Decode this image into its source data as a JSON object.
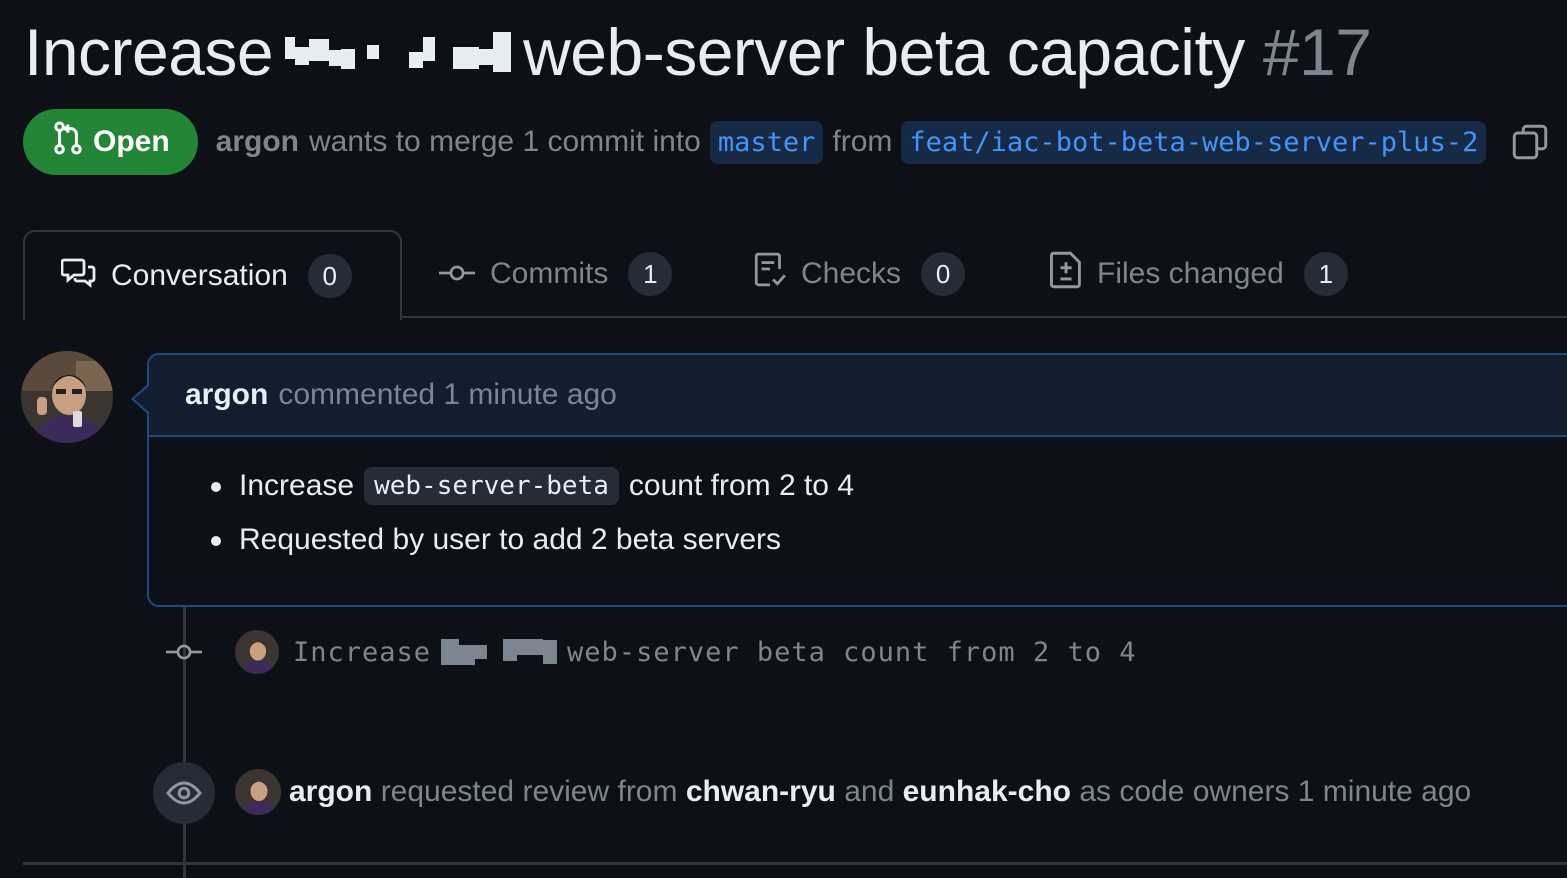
{
  "pr": {
    "title_start": "Increase",
    "title_end": "web-server beta capacity",
    "number": "#17",
    "state": "Open",
    "author": "argon",
    "merge_text": "wants to merge 1 commit into",
    "base_branch": "master",
    "from_text": "from",
    "head_branch": "feat/iac-bot-beta-web-server-plus-2"
  },
  "tabs": [
    {
      "label": "Conversation",
      "count": "0",
      "icon": "comment-discussion-icon"
    },
    {
      "label": "Commits",
      "count": "1",
      "icon": "git-commit-icon"
    },
    {
      "label": "Checks",
      "count": "0",
      "icon": "checklist-icon"
    },
    {
      "label": "Files changed",
      "count": "1",
      "icon": "file-diff-icon"
    }
  ],
  "comment": {
    "author": "argon",
    "action": "commented 1 minute ago",
    "bullet1_pre": "Increase",
    "bullet1_code": "web-server-beta",
    "bullet1_post": "count from 2 to 4",
    "bullet2": "Requested by user to add 2 beta servers"
  },
  "commit": {
    "msg_start": "Increase",
    "msg_end": "web-server beta count from 2 to 4"
  },
  "review_event": {
    "author": "argon",
    "text1": "requested review from",
    "reviewer1": "chwan-ryu",
    "and": "and",
    "reviewer2": "eunhak-cho",
    "text2": "as code owners 1 minute ago"
  },
  "colors": {
    "background": "#0d1117",
    "open_badge": "#238636",
    "branch_bg": "#172a45",
    "branch_text": "#4493f8",
    "comment_border": "#1f4a80"
  }
}
